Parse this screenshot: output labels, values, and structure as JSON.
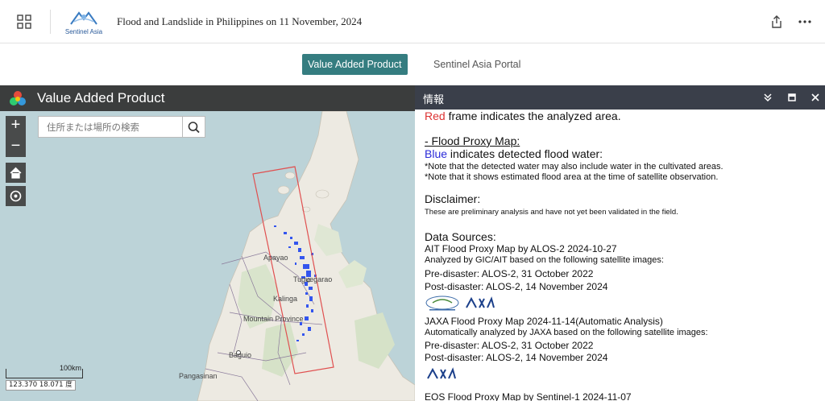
{
  "header": {
    "title": "Flood and Landslide in Philippines on 11 November, 2024",
    "logo_text": "Sentinel Asia"
  },
  "tabs": [
    {
      "label": "Value Added Product",
      "active": true
    },
    {
      "label": "Sentinel Asia Portal",
      "active": false
    }
  ],
  "map": {
    "title": "Value Added Product",
    "zoom_in": "+",
    "zoom_out": "−",
    "search_placeholder": "住所または場所の検索",
    "scale_label": "100km",
    "coords": "123.370 18.071 度",
    "labels": [
      "Apayao",
      "Tuguegarao",
      "Kalinga",
      "Mountain Province",
      "Baguio",
      "Pangasinan"
    ]
  },
  "info": {
    "title": "情報",
    "red_word": "Red",
    "red_rest": " frame indicates the analyzed area.",
    "flood_proxy_heading": "- Flood Proxy Map:",
    "blue_word": "Blue",
    "blue_rest": " indicates detected flood water:",
    "note1": "*Note that the detected water may also include water in the cultivated areas.",
    "note2": "*Note that it shows estimated flood area at the time of satellite observation.",
    "disclaimer_heading": "Disclaimer:",
    "disclaimer_text": "These are preliminary analysis and have not yet been validated in the field.",
    "data_sources_heading": "Data Sources:",
    "sources": [
      {
        "title": "AIT Flood Proxy Map by ALOS-2 2024-10-27",
        "desc": "Analyzed by GIC/AIT based on the following satellite images:",
        "pre": "Pre-disaster: ALOS-2, 31 October 2022",
        "post": "Post-disaster: ALOS-2, 14 November 2024"
      },
      {
        "title": "JAXA Flood Proxy Map 2024-11-14(Automatic Analysis)",
        "desc": "Automatically analyzed by JAXA based on the following satellite images:",
        "pre": "Pre-disaster: ALOS-2, 31 October 2022",
        "post": "Post-disaster: ALOS-2, 14 November 2024"
      },
      {
        "title": "EOS Flood Proxy Map by Sentinel-1 2024-11-07"
      }
    ]
  },
  "colors": {
    "accent": "#357d80",
    "panel_header": "#3a3f4a",
    "frame": "#e05050",
    "flood": "#3355ee"
  }
}
